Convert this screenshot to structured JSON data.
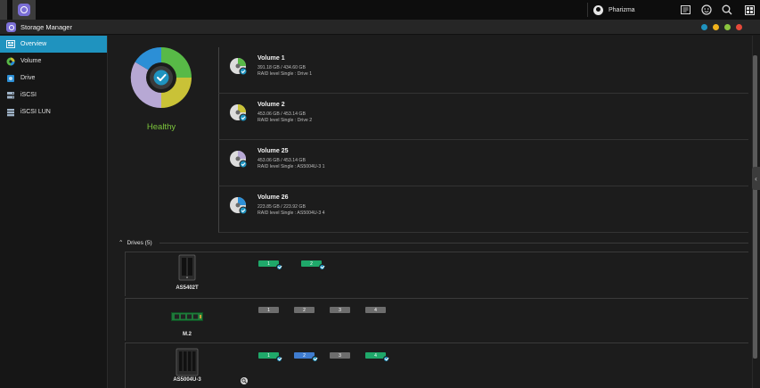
{
  "topbar": {
    "user_name": "Pharizma",
    "icons": [
      "app-grid-icon",
      "notes-icon",
      "face-icon",
      "search-icon",
      "dashboard-icon"
    ]
  },
  "window": {
    "title": "Storage Manager",
    "controls": [
      "#1f93bf",
      "#f2b31c",
      "#8bc53f",
      "#e5493a"
    ]
  },
  "sidebar": {
    "items": [
      {
        "label": "Overview",
        "icon": "overview-icon",
        "active": true
      },
      {
        "label": "Volume",
        "icon": "volume-icon",
        "active": false
      },
      {
        "label": "Drive",
        "icon": "drive-icon",
        "active": false
      },
      {
        "label": "iSCSI",
        "icon": "iscsi-icon",
        "active": false
      },
      {
        "label": "iSCSI LUN",
        "icon": "iscsi-lun-icon",
        "active": false
      }
    ]
  },
  "overview": {
    "status": "Healthy",
    "status_color": "#7cc53c",
    "donut_colors": [
      "#58b947",
      "#c9c237",
      "#b7a8d4",
      "#2c8fd6"
    ]
  },
  "volumes": [
    {
      "name": "Volume 1",
      "size": "391.18 GB / 434.60 GB",
      "raid": "RAID level Single : Drive 1",
      "disk_color": "#58b947"
    },
    {
      "name": "Volume 2",
      "size": "453.06 GB / 453.14 GB",
      "raid": "RAID level Single : Drive 2",
      "disk_color": "#c9c237"
    },
    {
      "name": "Volume 25",
      "size": "453.06 GB / 453.14 GB",
      "raid": "RAID level Single : AS5004U-3 1",
      "disk_color": "#b7a8d4"
    },
    {
      "name": "Volume 26",
      "size": "223.85 GB / 223.92 GB",
      "raid": "RAID level Single : AS5004U-3 4",
      "disk_color": "#2c8fd6"
    }
  ],
  "drives": {
    "header": "Drives (5)",
    "devices": [
      {
        "name": "AS5402T",
        "slots": [
          {
            "label": "1",
            "state": "green",
            "checked": true
          },
          {
            "label": "2",
            "state": "green",
            "checked": true
          }
        ]
      },
      {
        "name": "M.2",
        "slots": [
          {
            "label": "1",
            "state": "gray",
            "checked": false
          },
          {
            "label": "2",
            "state": "gray",
            "checked": false
          },
          {
            "label": "3",
            "state": "gray",
            "checked": false
          },
          {
            "label": "4",
            "state": "gray",
            "checked": false
          }
        ]
      },
      {
        "name": "AS5004U-3",
        "slots": [
          {
            "label": "1",
            "state": "green",
            "checked": true
          },
          {
            "label": "2",
            "state": "blue",
            "checked": true
          },
          {
            "label": "3",
            "state": "gray",
            "checked": false
          },
          {
            "label": "4",
            "state": "green",
            "checked": true
          }
        ]
      }
    ]
  }
}
